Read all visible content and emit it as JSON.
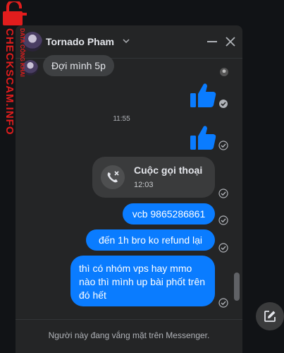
{
  "watermark": {
    "text": "CHECKSCAM.INFO",
    "sub_text": "DATA CÔNG KHAI",
    "icon": "lock-icon",
    "color": "#e11d1d"
  },
  "chat": {
    "contact_name": "Tornado Pham",
    "incoming_message": "Đợi mình 5p",
    "time_divider": "11:55",
    "call": {
      "title": "Cuộc gọi thoại",
      "time": "12:03",
      "icon": "missed-call-icon"
    },
    "outgoing_messages": [
      "vcb 9865286861",
      "đến 1h bro ko refund lại",
      "thì có nhóm vps hay mmo nào thì mình up bài phốt trên đó hết"
    ],
    "footer_text": "Người này đang vắng mặt trên Messenger.",
    "colors": {
      "outgoing_bubble": "#0a7cff",
      "incoming_bubble": "#3e4042",
      "background": "#242526",
      "like": "#0a7cff"
    }
  }
}
